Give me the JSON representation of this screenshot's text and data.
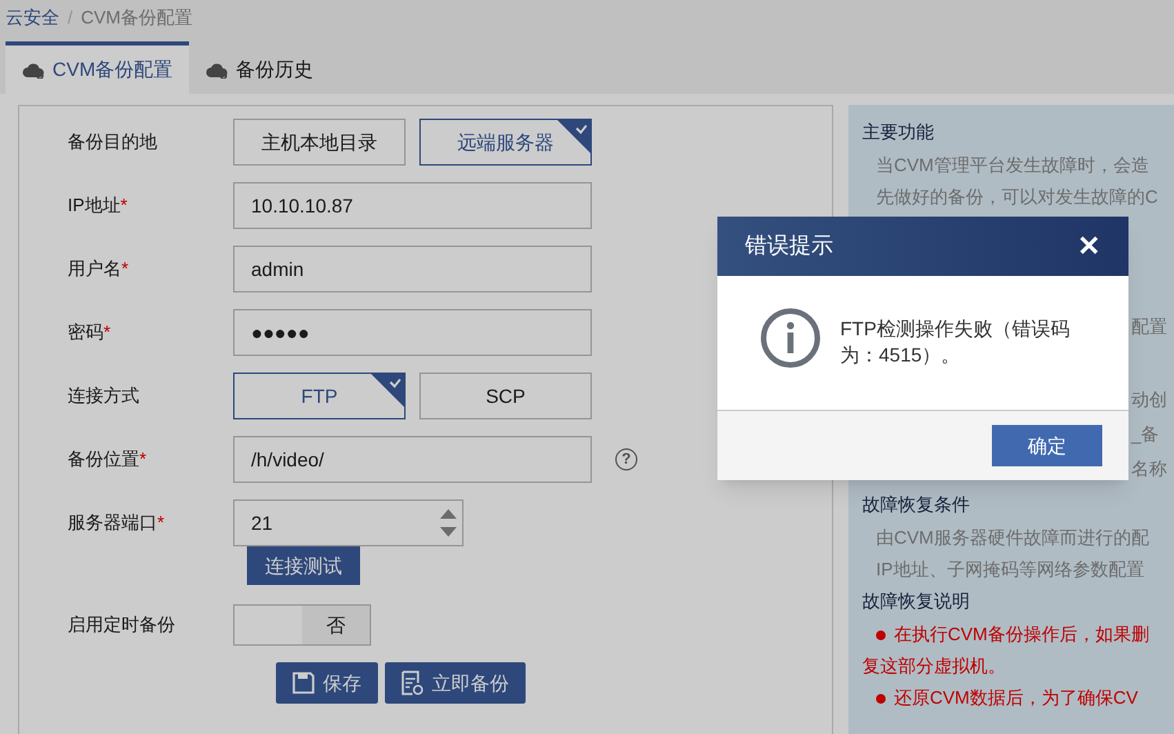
{
  "breadcrumb": {
    "separator": "/",
    "items": [
      {
        "label": "云安全",
        "kind": "link"
      },
      {
        "label": "CVM备份配置",
        "kind": "current"
      }
    ]
  },
  "tabs": [
    {
      "label": "CVM备份配置",
      "selected": true
    },
    {
      "label": "备份历史",
      "selected": false
    }
  ],
  "form": {
    "rows": [
      {
        "kind": "options",
        "label": "备份目的地",
        "options": [
          {
            "label": "主机本地目录",
            "selected": false
          },
          {
            "label": "远端服务器",
            "selected": true
          }
        ]
      },
      {
        "kind": "text",
        "label": "IP地址",
        "required_mark": "*",
        "value": "10.10.10.87"
      },
      {
        "kind": "text",
        "label": "用户名",
        "required_mark": "*",
        "value": "admin"
      },
      {
        "kind": "text",
        "label": "密码",
        "required_mark": "*",
        "value": "●●●●●"
      },
      {
        "kind": "options",
        "label": "连接方式",
        "options": [
          {
            "label": "FTP",
            "selected": true
          },
          {
            "label": "SCP",
            "selected": false
          }
        ]
      },
      {
        "kind": "help",
        "label": "备份位置",
        "required_mark": "*",
        "value": "/h/video/",
        "help": "?"
      },
      {
        "kind": "spin",
        "label": "服务器端口",
        "required_mark": "*",
        "value": "21"
      },
      {
        "kind": "button",
        "label": "连接测试"
      },
      {
        "kind": "toggle",
        "label": "启用定时备份",
        "on": false,
        "state_label": "否"
      }
    ],
    "actions": [
      {
        "kind": "save",
        "label": "保存"
      },
      {
        "kind": "backup",
        "label": "立即备份"
      }
    ]
  },
  "info": {
    "sections": [
      {
        "title": "主要功能",
        "lines": [
          "当CVM管理平台发生故障时，会造",
          "先做好的备份，可以对发生故障的C"
        ],
        "fragments": [
          "配置",
          "动创",
          "_备",
          "名称"
        ]
      },
      {
        "title": "故障恢复条件",
        "lines": [
          "由CVM服务器硬件故障而进行的配",
          "IP地址、子网掩码等网络参数配置"
        ]
      },
      {
        "title": "故障恢复说明",
        "warnings": [
          "在执行CVM备份操作后，如果删",
          "复这部分虚拟机。",
          "还原CVM数据后，为了确保CV"
        ]
      }
    ]
  },
  "dialog": {
    "title": "错误提示",
    "close": "✕",
    "message": "FTP检测操作失败（错误码为：4515）。",
    "button": "确定"
  }
}
